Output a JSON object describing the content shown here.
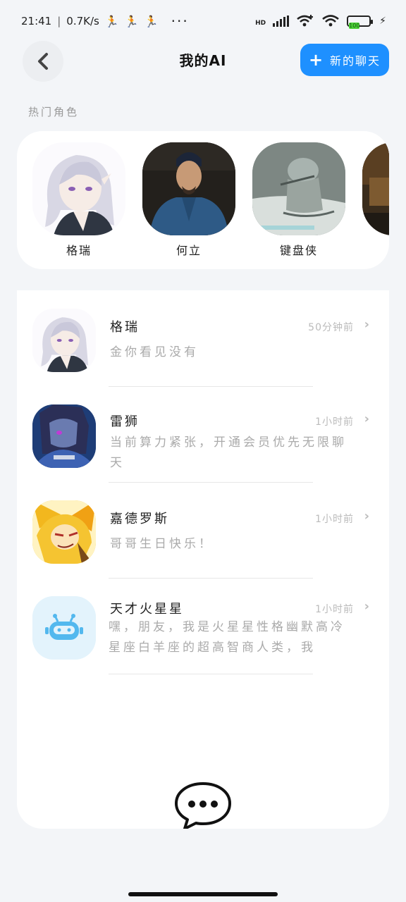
{
  "status_bar": {
    "time": "21:41",
    "speed": "0.7K/s",
    "more": "···",
    "network": "HD",
    "battery_level": "100",
    "icons": [
      "runner-icon",
      "runner-icon",
      "runner-icon",
      "signal-icon",
      "wifi-plus-icon",
      "wifi-icon",
      "battery-icon",
      "charging-icon"
    ]
  },
  "header": {
    "title": "我的AI",
    "new_chat_label": "新的聊天",
    "back_icon": "back-chevron-icon",
    "accent": "#1e90ff"
  },
  "hot_roles": {
    "label": "热门角色",
    "items": [
      {
        "name": "格瑞",
        "icon": "silver-hair-character-avatar"
      },
      {
        "name": "何立",
        "icon": "man-in-blue-robe-avatar"
      },
      {
        "name": "键盘侠",
        "icon": "sketch-character-avatar"
      },
      {
        "name": "",
        "icon": "partial-avatar"
      }
    ]
  },
  "chats": [
    {
      "name": "格瑞",
      "time": "50分钟前",
      "message": "金你看见没有",
      "icon": "silver-hair-character-avatar"
    },
    {
      "name": "雷狮",
      "time": "1小时前",
      "message": "当前算力紧张，开通会员优先无限聊天",
      "icon": "hooded-character-avatar"
    },
    {
      "name": "嘉德罗斯",
      "time": "1小时前",
      "message": "哥哥生日快乐！",
      "icon": "blonde-character-avatar"
    },
    {
      "name": "天才火星星",
      "time": "1小时前",
      "message": "嘿，朋友，我是火星星性格幽默高冷星座白羊座的超高智商人类，我",
      "icon": "robot-icon"
    }
  ],
  "footer": {
    "icon": "chat-bubble-icon"
  }
}
